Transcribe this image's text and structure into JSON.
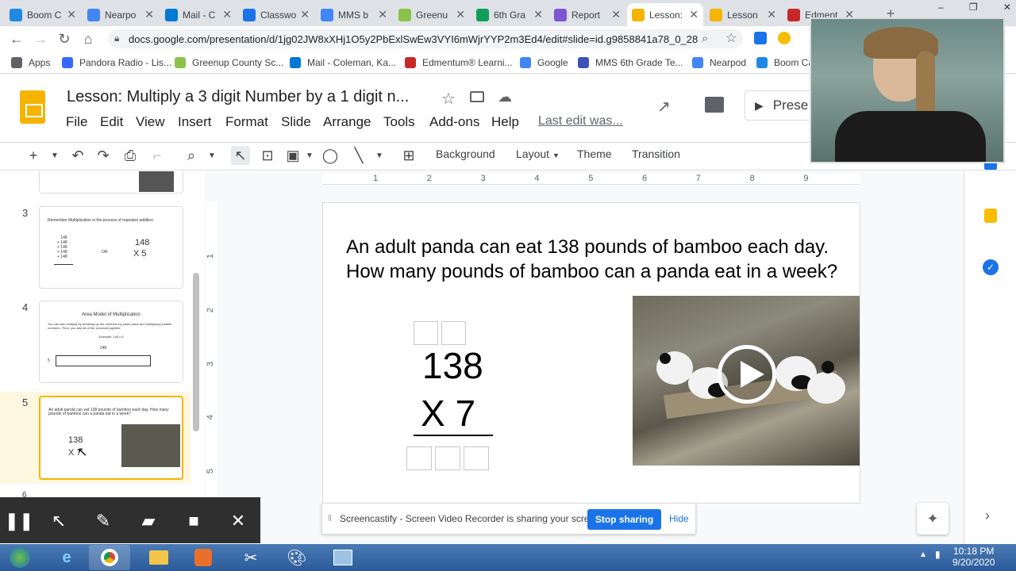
{
  "browser": {
    "tabs": [
      {
        "label": "Boom C",
        "color": "#1e88e5",
        "icon": "boom-icon"
      },
      {
        "label": "Nearpo",
        "color": "#4285f4",
        "icon": "nearpod-icon"
      },
      {
        "label": "Mail - C",
        "color": "#0078d4",
        "icon": "outlook-icon"
      },
      {
        "label": "Classwo",
        "color": "#1a73e8",
        "icon": "classroom-icon"
      },
      {
        "label": "MMS b",
        "color": "#4285f4",
        "icon": "docs-icon"
      },
      {
        "label": "Greenu",
        "color": "#8bc34a",
        "icon": "greenup-icon"
      },
      {
        "label": "6th Gra",
        "color": "#0f9d58",
        "icon": "sheets-icon"
      },
      {
        "label": "Report",
        "color": "#7b57d1",
        "icon": "report-icon"
      },
      {
        "label": "Lesson:",
        "color": "#f4b400",
        "icon": "slides-icon",
        "active": true
      },
      {
        "label": "Lesson",
        "color": "#f4b400",
        "icon": "slides-icon"
      },
      {
        "label": "Edment",
        "color": "#c62828",
        "icon": "edmentum-icon"
      }
    ],
    "url": "docs.google.com/presentation/d/1jg02JW8xXHj1O5y2PbExlSwEw3VYI6mWjrYYP2m3Ed4/edit#slide=id.g9858841a78_0_28",
    "bookmarks": [
      {
        "label": "Apps",
        "color": "#5f6368"
      },
      {
        "label": "Pandora Radio - Lis...",
        "color": "#3668ff"
      },
      {
        "label": "Greenup County Sc...",
        "color": "#8bc34a"
      },
      {
        "label": "Mail - Coleman, Ka...",
        "color": "#0078d4"
      },
      {
        "label": "Edmentum® Learni...",
        "color": "#c62828"
      },
      {
        "label": "Google",
        "color": "#4285f4"
      },
      {
        "label": "MMS 6th Grade Te...",
        "color": "#3f51b5"
      },
      {
        "label": "Nearpod",
        "color": "#4285f4"
      },
      {
        "label": "Boom Ca",
        "color": "#1e88e5"
      }
    ]
  },
  "docs": {
    "title": "Lesson: Multiply a 3 digit Number by a 1 digit n...",
    "menus": [
      "File",
      "Edit",
      "View",
      "Insert",
      "Format",
      "Slide",
      "Arrange",
      "Tools",
      "Add-ons",
      "Help"
    ],
    "last_edit": "Last edit was...",
    "present_label": "Prese",
    "toolbar": {
      "background": "Background",
      "layout": "Layout",
      "theme": "Theme",
      "transition": "Transition"
    }
  },
  "filmstrip": {
    "slide3": {
      "number": "3",
      "text": "Remember Multiplication is the process of repeated addition.",
      "stack": "148\n+ 148\n+ 148\n+ 148\n+ 148",
      "or": "OR",
      "num": "148",
      "mul": "X 5"
    },
    "slide4": {
      "number": "4",
      "title": "Area Model of Multiplication",
      "text": "You can also multiply by breaking up the numbers by place value and multiplying smaller numbers. Then, you add all of the products together.",
      "example": "Example: 148 x 5",
      "num": "148",
      "row_label": "5"
    },
    "slide5": {
      "number": "5",
      "text": "An adult panda can eat 138 pounds of bamboo each day. How many pounds of bamboo can a panda eat in a week?",
      "num": "138",
      "mul": "X 7"
    },
    "slide6": {
      "number": "6"
    }
  },
  "rulers": {
    "h": [
      "1",
      "2",
      "3",
      "4",
      "5",
      "6",
      "7",
      "8",
      "9"
    ],
    "v": [
      "1",
      "2",
      "3",
      "4",
      "5"
    ]
  },
  "slide": {
    "question": "An adult panda can eat 138 pounds of bamboo each day. How many pounds of bamboo can a panda eat in a week?",
    "number": "138",
    "multiplier": "X 7"
  },
  "screencastify": {
    "message": "Screencastify - Screen Video Recorder is sharing your screen.",
    "stop": "Stop sharing",
    "hide": "Hide"
  },
  "taskbar": {
    "time": "10:18 PM",
    "date": "9/20/2020"
  }
}
